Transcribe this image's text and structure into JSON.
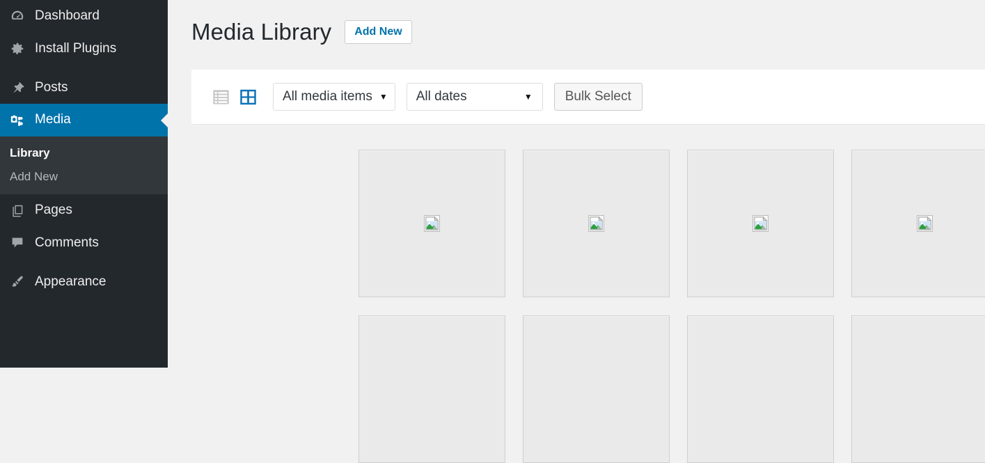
{
  "colors": {
    "sidebar_bg": "#23282d",
    "submenu_bg": "#32373c",
    "accent_blue": "#0073aa",
    "page_bg": "#f1f1f1",
    "panel_bg": "#ffffff",
    "thumb_bg": "#eaeaea",
    "link_blue": "#0073aa"
  },
  "sidebar": {
    "items": [
      {
        "label": "Dashboard",
        "icon": "dashboard-gauge-icon",
        "active": false
      },
      {
        "label": "Install Plugins",
        "icon": "gear-icon",
        "active": false
      },
      {
        "label": "Posts",
        "icon": "pushpin-icon",
        "active": false
      },
      {
        "label": "Media",
        "icon": "media-camera-icon",
        "active": true
      },
      {
        "label": "Pages",
        "icon": "pages-stack-icon",
        "active": false
      },
      {
        "label": "Comments",
        "icon": "comment-bubble-icon",
        "active": false
      },
      {
        "label": "Appearance",
        "icon": "paintbrush-icon",
        "active": false
      }
    ],
    "submenu": [
      {
        "label": "Library",
        "current": true
      },
      {
        "label": "Add New",
        "current": false
      }
    ]
  },
  "header": {
    "title": "Media Library",
    "add_new_label": "Add New"
  },
  "toolbar": {
    "list_view_icon": "list-view-icon",
    "grid_view_icon": "grid-view-icon",
    "active_view": "grid",
    "media_filter": {
      "value": "All media items",
      "caret": "▼"
    },
    "date_filter": {
      "value": "All dates",
      "caret": "▼"
    },
    "bulk_select_label": "Bulk Select"
  },
  "grid": {
    "placeholder_icon": "broken-image-icon",
    "rows": [
      {
        "items": [
          {
            "name": "media-item-1"
          },
          {
            "name": "media-item-2"
          },
          {
            "name": "media-item-3"
          },
          {
            "name": "media-item-4"
          },
          {
            "name": "media-item-5"
          },
          {
            "name": "media-item-6"
          }
        ]
      },
      {
        "items": [
          {
            "name": "media-item-7"
          },
          {
            "name": "media-item-8"
          },
          {
            "name": "media-item-9"
          },
          {
            "name": "media-item-10"
          },
          {
            "name": "media-item-11"
          },
          {
            "name": "media-item-12"
          }
        ]
      }
    ]
  }
}
